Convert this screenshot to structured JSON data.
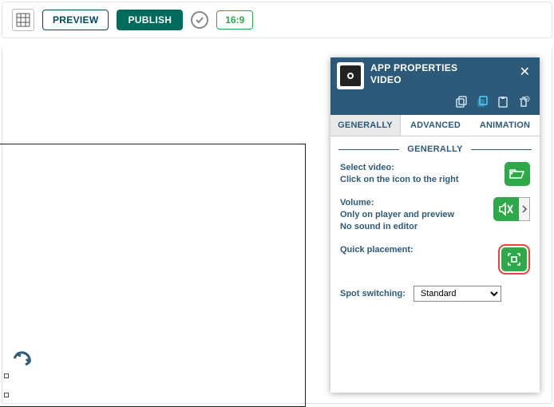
{
  "toolbar": {
    "preview_label": "PREVIEW",
    "publish_label": "PUBLISH",
    "aspect_ratio": "16:9"
  },
  "panel": {
    "title_line1": "APP PROPERTIES",
    "title_line2": "VIDEO",
    "tabs": {
      "generally": "GENERALLY",
      "advanced": "ADVANCED",
      "animation": "ANIMATION"
    },
    "section_title": "GENERALLY",
    "rows": {
      "select_video": {
        "label": "Select video:",
        "sub": "Click on the icon to the right"
      },
      "volume": {
        "label": "Volume:",
        "sub1": "Only on player and preview",
        "sub2": "No sound in editor"
      },
      "quick_placement": {
        "label": "Quick placement:"
      },
      "spot_switching": {
        "label": "Spot switching:",
        "selected": "Standard",
        "options": [
          "Standard"
        ]
      }
    }
  },
  "colors": {
    "header_bg": "#2e5a7a",
    "accent_green": "#2fa84a",
    "highlight_red": "#e43",
    "publish_green": "#006b5a"
  }
}
